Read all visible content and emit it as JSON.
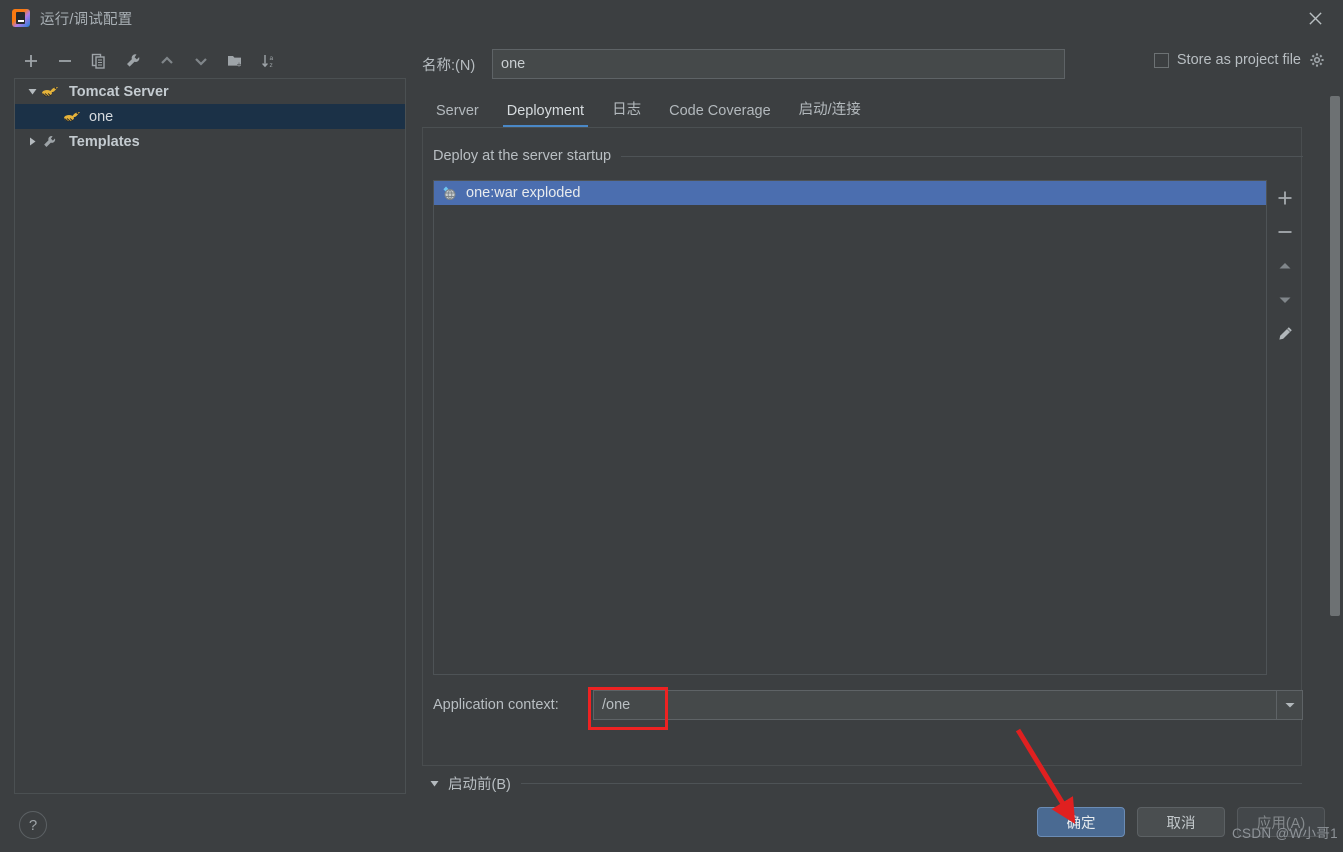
{
  "window": {
    "title": "运行/调试配置",
    "app_icon": "intellij-idea-icon",
    "close_icon": "close-icon"
  },
  "left_toolbar": {
    "buttons": [
      {
        "name": "add-configuration-button",
        "icon": "plus-icon",
        "label": "+"
      },
      {
        "name": "remove-configuration-button",
        "icon": "minus-icon",
        "label": "−"
      },
      {
        "name": "copy-configuration-button",
        "icon": "copy-icon",
        "label": "Copy"
      },
      {
        "name": "edit-templates-button",
        "icon": "wrench-icon",
        "label": "Edit Templates"
      },
      {
        "name": "move-up-button",
        "icon": "chevron-up-icon",
        "label": "Move Up"
      },
      {
        "name": "move-down-button",
        "icon": "chevron-down-icon",
        "label": "Move Down"
      },
      {
        "name": "move-into-folder-button",
        "icon": "new-folder-icon",
        "label": "Move into new folder"
      },
      {
        "name": "sort-configurations-button",
        "icon": "sort-az-icon",
        "label": "Sort Configurations"
      }
    ]
  },
  "tree": {
    "nodes": [
      {
        "label": "Tomcat Server",
        "icon": "tomcat-icon",
        "expanded": true,
        "type": "group"
      },
      {
        "label": "one",
        "icon": "tomcat-icon",
        "type": "child",
        "selected": true
      },
      {
        "label": "Templates",
        "icon": "wrench-icon",
        "expanded": false,
        "type": "group"
      }
    ]
  },
  "help": {
    "label": "?",
    "icon": "question-mark-icon"
  },
  "name_field": {
    "label": "名称:(N)",
    "value": "one",
    "placeholder": ""
  },
  "store_as_project_file": {
    "label": "Store as project file",
    "checked": false,
    "gear_icon": "gear-icon"
  },
  "tabs": [
    {
      "label": "Server",
      "active": false
    },
    {
      "label": "Deployment",
      "active": true
    },
    {
      "label": "日志",
      "active": false
    },
    {
      "label": "Code Coverage",
      "active": false
    },
    {
      "label": "启动/连接",
      "active": false
    }
  ],
  "deployment": {
    "group_title": "Deploy at the server startup",
    "items": [
      {
        "label": "one:war exploded",
        "icon": "artifact-icon",
        "selected": true
      }
    ],
    "side_buttons": [
      {
        "name": "add-artifact-button",
        "icon": "plus-icon"
      },
      {
        "name": "remove-artifact-button",
        "icon": "minus-icon"
      },
      {
        "name": "move-artifact-up-button",
        "icon": "triangle-up-icon"
      },
      {
        "name": "move-artifact-down-button",
        "icon": "triangle-down-icon"
      },
      {
        "name": "edit-artifact-button",
        "icon": "pencil-icon"
      }
    ]
  },
  "application_context": {
    "label": "Application context:",
    "value": "/one",
    "placeholder": "",
    "dropdown_icon": "chevron-down-icon"
  },
  "before_launch": {
    "label": "启动前(B)",
    "expanded": true
  },
  "dialog_buttons": {
    "ok": "确定",
    "cancel": "取消",
    "apply": "应用(A)"
  },
  "annotations": {
    "watermark": "CSDN @W小哥1",
    "highlight_color": "#ee2222",
    "arrow_color": "#e02020"
  },
  "colors": {
    "background": "#3c3f41",
    "accent_blue": "#4a88c7",
    "selection_blue": "#4b6eaf",
    "tree_selection": "#1b3147",
    "text": "#bbbbbb"
  }
}
